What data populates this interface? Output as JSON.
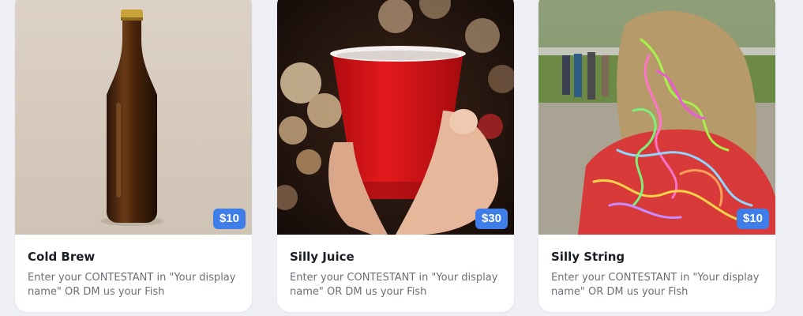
{
  "products": [
    {
      "title": "Cold Brew",
      "price": "$10",
      "description": "Enter your CONTESTANT in \"Your display name\" OR DM us your Fish",
      "image": "beer-bottle-photo"
    },
    {
      "title": "Silly Juice",
      "price": "$30",
      "description": "Enter your CONTESTANT in \"Your display name\" OR DM us your Fish",
      "image": "red-cup-photo"
    },
    {
      "title": "Silly String",
      "price": "$10",
      "description": "Enter your CONTESTANT in \"Your display name\" OR DM us your Fish",
      "image": "silly-string-photo"
    }
  ],
  "colors": {
    "background": "#eef0f6",
    "card": "#ffffff",
    "price_badge": "#3f7ee8",
    "title": "#1b1d24",
    "description": "#6d6f78"
  }
}
